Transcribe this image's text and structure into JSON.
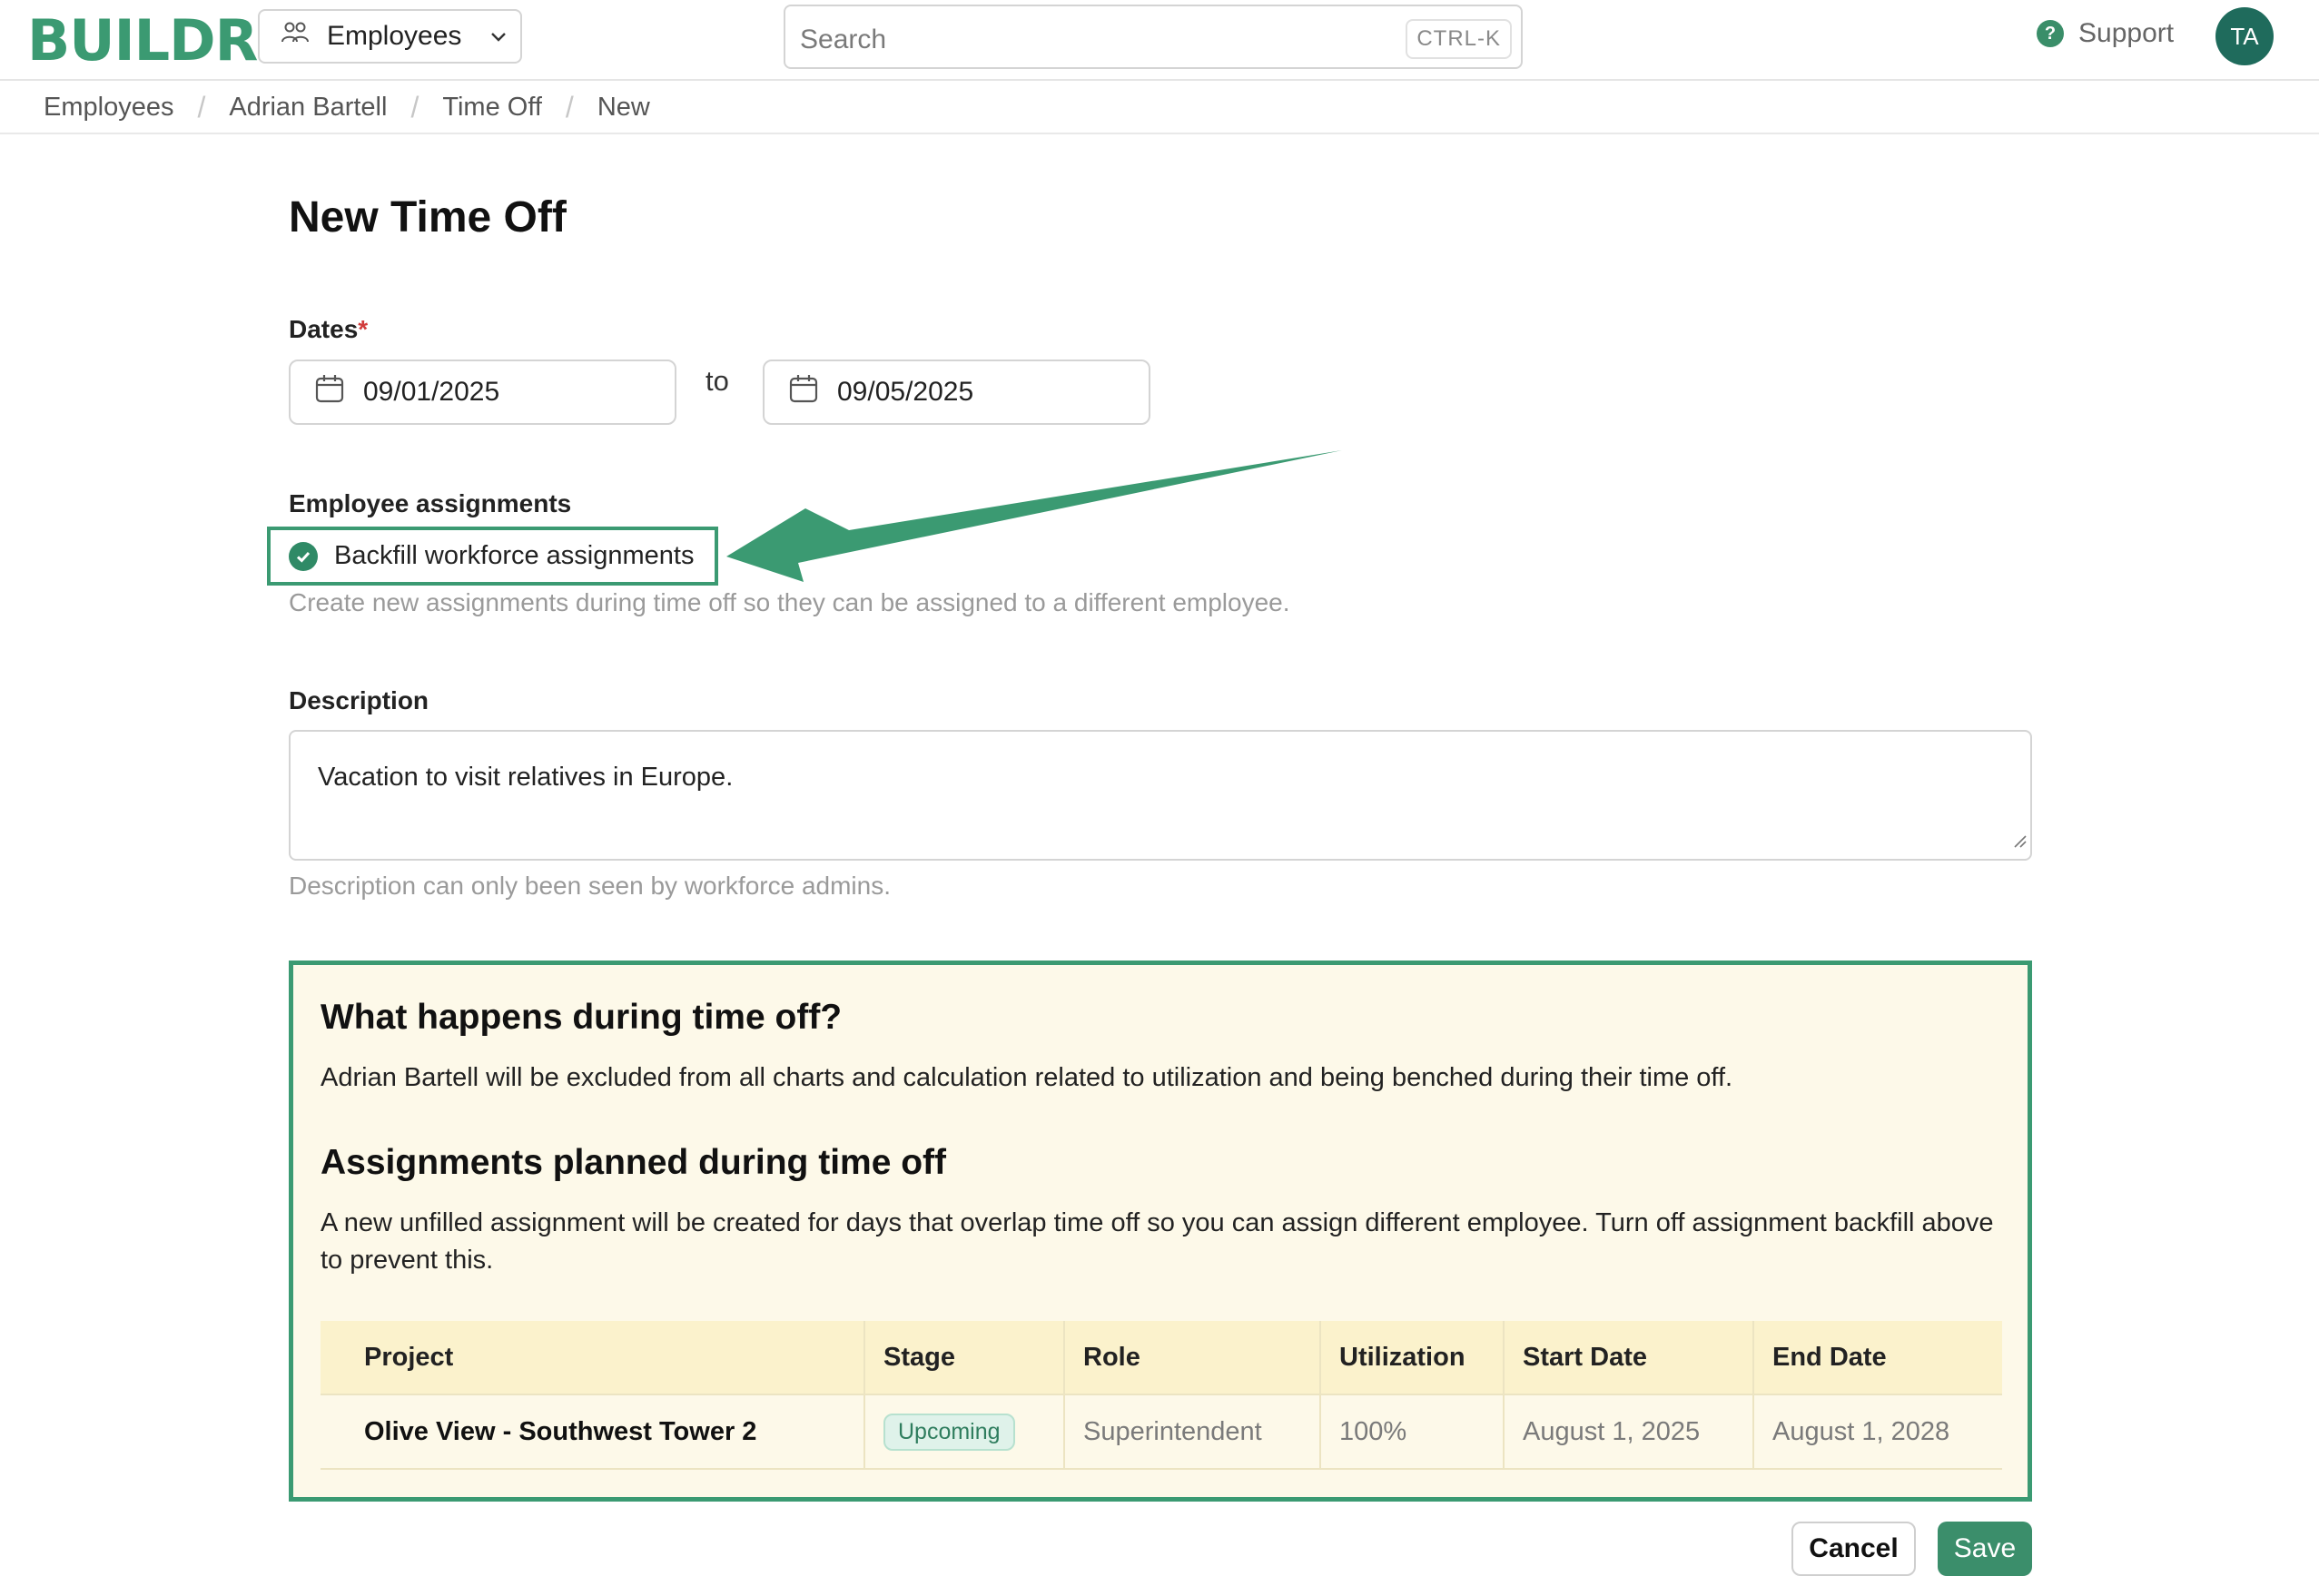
{
  "app": {
    "logo": "BUILDR",
    "module_label": "Employees",
    "search_placeholder": "Search",
    "search_shortcut": "CTRL-K",
    "support_label": "Support",
    "avatar_initials": "TA",
    "accent_color": "#3b9a72"
  },
  "breadcrumb": [
    "Employees",
    "Adrian Bartell",
    "Time Off",
    "New"
  ],
  "page": {
    "title": "New Time Off",
    "dates": {
      "label": "Dates",
      "required_mark": "*",
      "start": "09/01/2025",
      "to_label": "to",
      "end": "09/05/2025"
    },
    "assignments": {
      "label": "Employee assignments",
      "checkbox_label": "Backfill workforce assignments",
      "checked": true,
      "hint": "Create new assignments during time off so they can be assigned to a different employee."
    },
    "description": {
      "label": "Description",
      "value": "Vacation to visit relatives in Europe.",
      "hint": "Description can only been seen by workforce admins."
    },
    "info": {
      "heading1": "What happens during time off?",
      "text1": "Adrian Bartell will be excluded from all charts and calculation related to utilization and being benched during their time off.",
      "heading2": "Assignments planned during time off",
      "text2": "A new unfilled assignment will be created for days that overlap time off so you can assign different employee. Turn off assignment backfill above to prevent this.",
      "table": {
        "columns": [
          "Project",
          "Stage",
          "Role",
          "Utilization",
          "Start Date",
          "End Date"
        ],
        "rows": [
          {
            "project": "Olive View - Southwest Tower 2",
            "stage": "Upcoming",
            "role": "Superintendent",
            "utilization": "100%",
            "start": "August 1, 2025",
            "end": "August 1, 2028"
          }
        ]
      }
    },
    "actions": {
      "cancel": "Cancel",
      "save": "Save"
    }
  }
}
